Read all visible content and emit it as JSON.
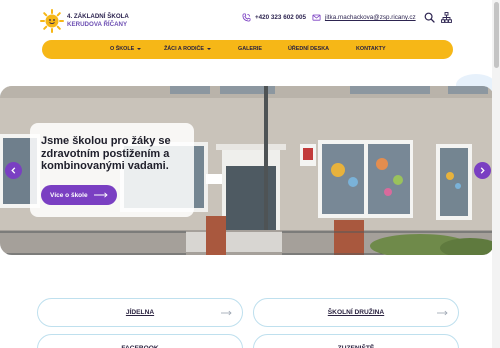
{
  "logo": {
    "line1": "4. základní škola",
    "line2": "Kerudova Říčany",
    "icon": "sun-logo-icon"
  },
  "header": {
    "phone": "+420 323 602 005",
    "email": "jitka.machackova@zsp.ricany.cz",
    "icons": [
      "phone-icon",
      "email-icon",
      "search-icon",
      "sitemap-icon"
    ]
  },
  "nav": {
    "items": [
      {
        "label": "O škole",
        "has_dropdown": true
      },
      {
        "label": "Žáci a rodiče",
        "has_dropdown": true
      },
      {
        "label": "Galerie",
        "has_dropdown": false
      },
      {
        "label": "Úřední deska",
        "has_dropdown": false
      },
      {
        "label": "Kontakty",
        "has_dropdown": false
      }
    ]
  },
  "hero": {
    "title": "Jsme školou pro žáky se zdravotním postižením a kombinovanými vadami.",
    "button_label": "Více o škole",
    "prev_icon": "chevron-left-icon",
    "next_icon": "chevron-right-icon"
  },
  "quick_links": [
    {
      "label": "Jídelna"
    },
    {
      "label": "Školní družina"
    },
    {
      "label": "Facebook"
    },
    {
      "label": "Zuzeniště"
    }
  ],
  "colors": {
    "accent_purple": "#7a3fc2",
    "nav_yellow": "#f6b717",
    "link_border": "#bfe0ee",
    "text_dark": "#2a2240"
  }
}
